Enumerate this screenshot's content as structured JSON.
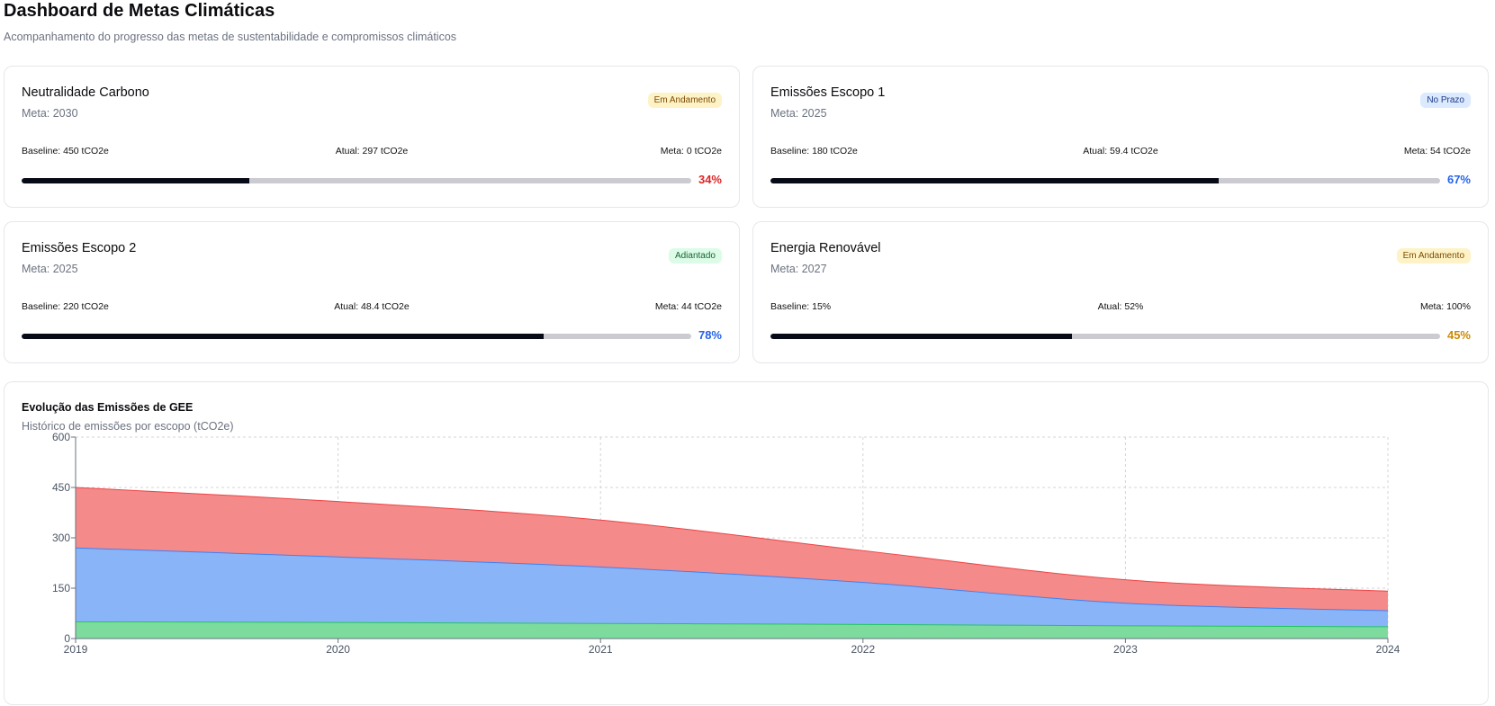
{
  "header": {
    "title": "Dashboard de Metas Climáticas",
    "subtitle": "Acompanhamento do progresso das metas de sustentabilidade e compromissos climáticos"
  },
  "goals": [
    {
      "name": "Neutralidade Carbono",
      "target": "Meta: 2030",
      "status": "Em Andamento",
      "status_color": "yellow",
      "baseline": "Baseline: 450 tCO2e",
      "current": "Atual: 297 tCO2e",
      "goal": "Meta: 0 tCO2e",
      "progress_label": "34%",
      "progress": 34,
      "progress_color": "#dc2626"
    },
    {
      "name": "Emissões Escopo 1",
      "target": "Meta: 2025",
      "status": "No Prazo",
      "status_color": "blue",
      "baseline": "Baseline: 180 tCO2e",
      "current": "Atual: 59.4 tCO2e",
      "goal": "Meta: 54 tCO2e",
      "progress_label": "67%",
      "progress": 67,
      "progress_color": "#2563eb"
    },
    {
      "name": "Emissões Escopo 2",
      "target": "Meta: 2025",
      "status": "Adiantado",
      "status_color": "green",
      "baseline": "Baseline: 220 tCO2e",
      "current": "Atual: 48.4 tCO2e",
      "goal": "Meta: 44 tCO2e",
      "progress_label": "78%",
      "progress": 78,
      "progress_color": "#2563eb"
    },
    {
      "name": "Energia Renovável",
      "target": "Meta: 2027",
      "status": "Em Andamento",
      "status_color": "yellow",
      "baseline": "Baseline: 15%",
      "current": "Atual: 52%",
      "goal": "Meta: 100%",
      "progress_label": "45%",
      "progress": 45,
      "progress_color": "#ca8a04"
    }
  ],
  "chart": {
    "title": "Evolução das Emissões de GEE",
    "subtitle": "Histórico de emissões por escopo (tCO2e)"
  },
  "chart_data": {
    "type": "area",
    "stacked": true,
    "x": [
      "2019",
      "2020",
      "2021",
      "2022",
      "2023",
      "2024"
    ],
    "ylim": [
      0,
      600
    ],
    "yticks": [
      0,
      150,
      300,
      450,
      600
    ],
    "grid": true,
    "series": [
      {
        "color": "#7ddb9e",
        "stroke": "#22c55e",
        "values": [
          50,
          48,
          45,
          42,
          38,
          35
        ]
      },
      {
        "color": "#8ab4f8",
        "stroke": "#3b82f6",
        "values": [
          220,
          195,
          168,
          125,
          67,
          48
        ]
      },
      {
        "color": "#f48a8a",
        "stroke": "#ef4444",
        "values": [
          180,
          165,
          140,
          95,
          70,
          58
        ]
      }
    ]
  }
}
